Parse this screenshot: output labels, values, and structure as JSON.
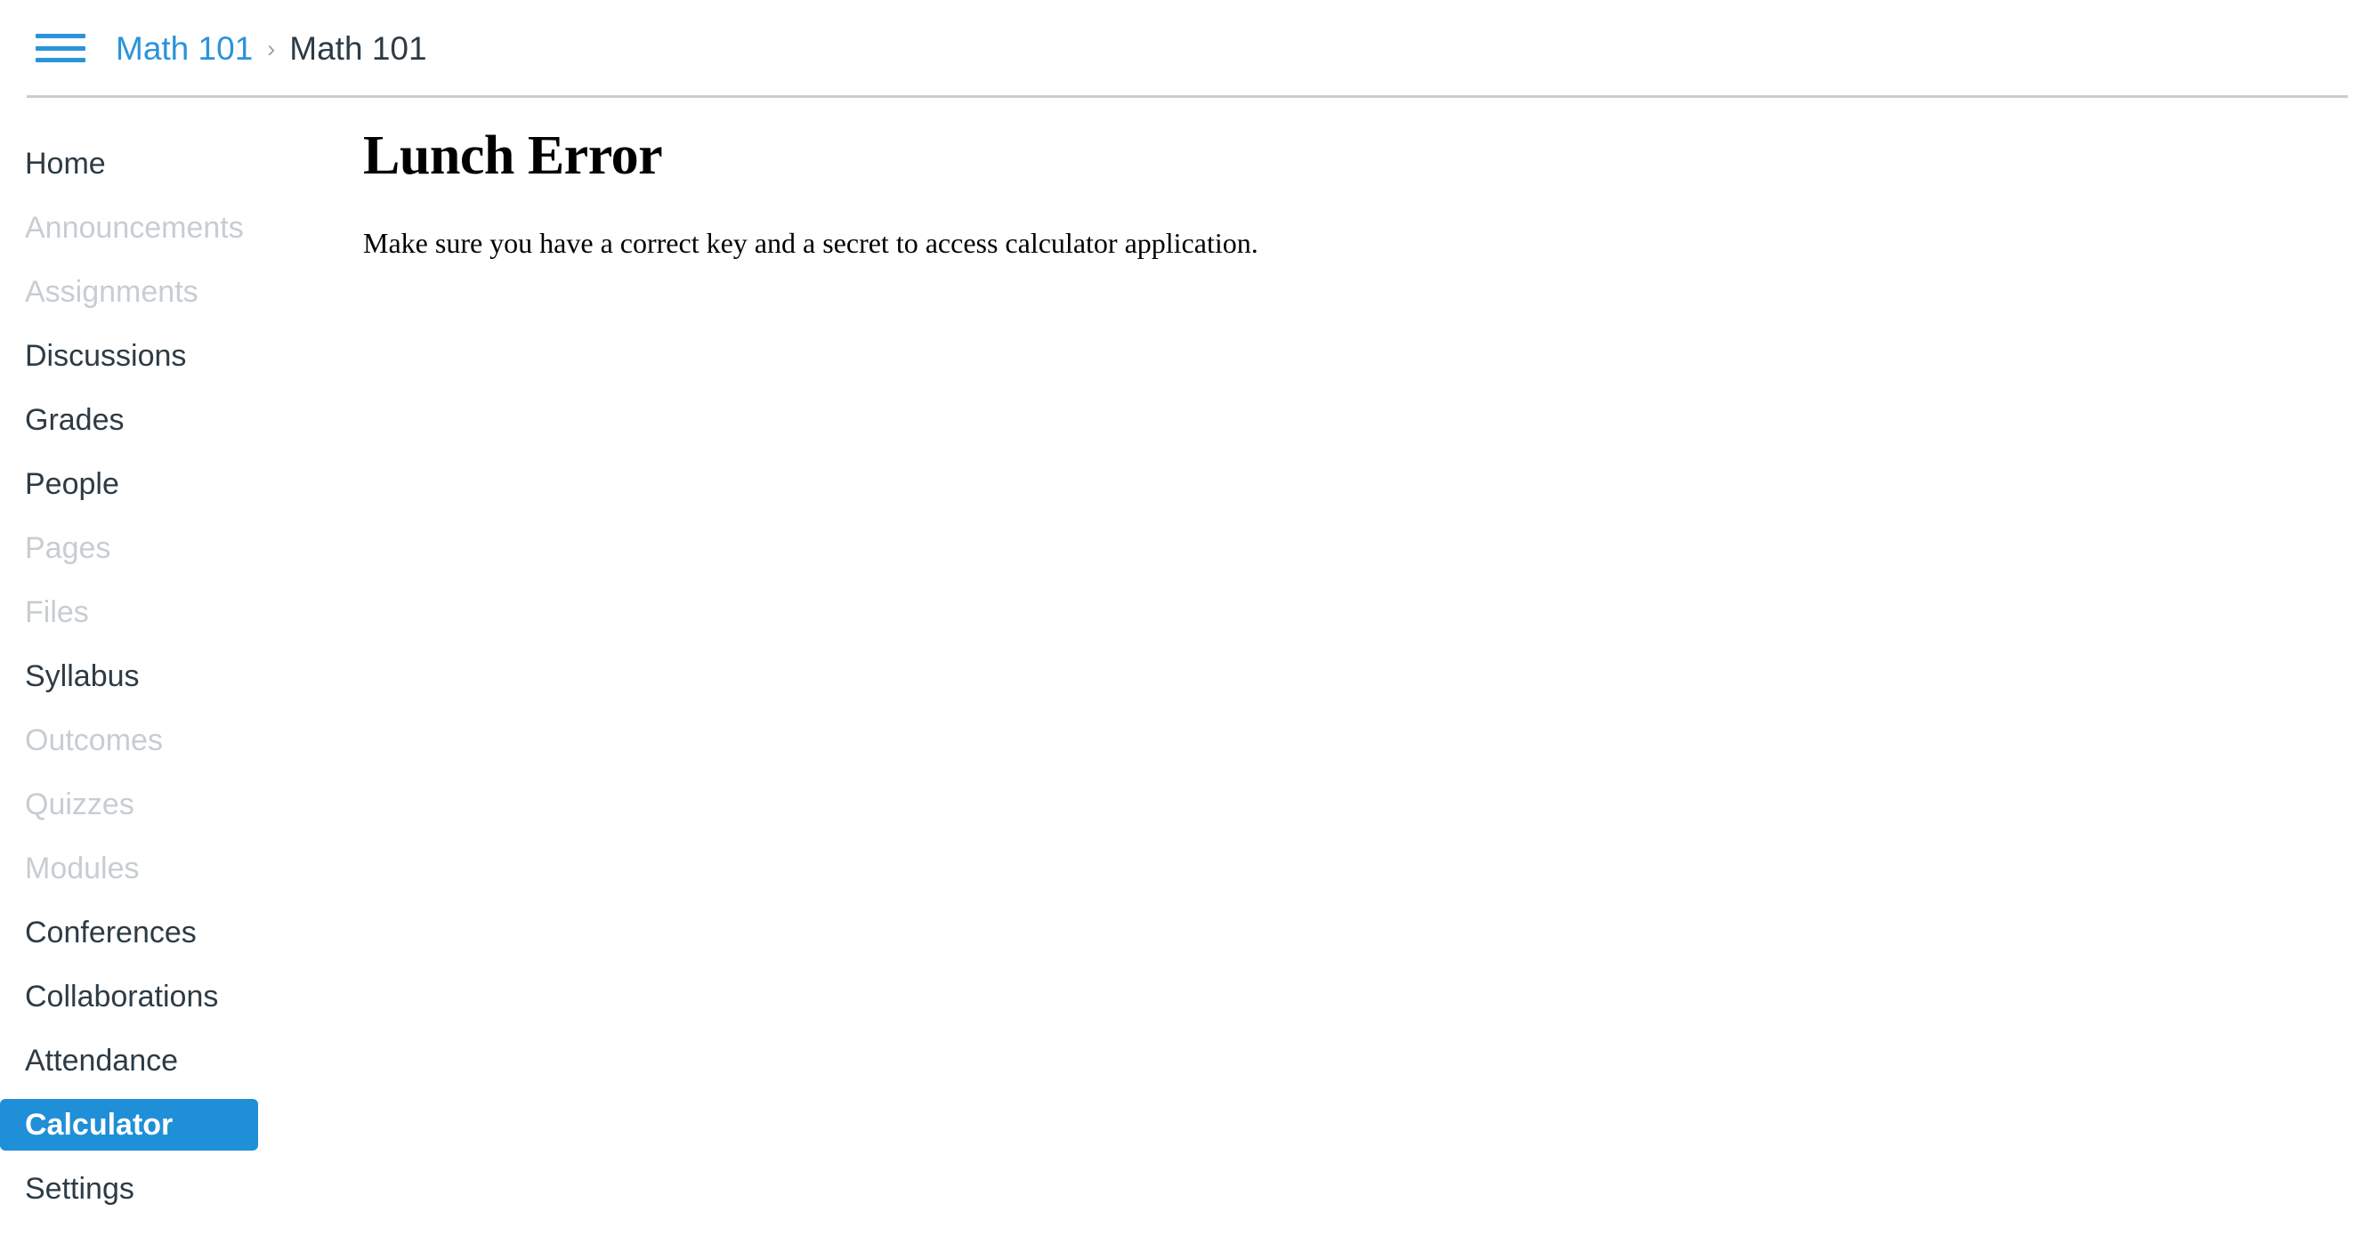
{
  "header": {
    "menu_icon": "hamburger-icon",
    "breadcrumb": {
      "parent": "Math 101",
      "separator": "›",
      "current": "Math 101"
    }
  },
  "sidebar": {
    "items": [
      {
        "label": "Home",
        "state": "enabled"
      },
      {
        "label": "Announcements",
        "state": "disabled"
      },
      {
        "label": "Assignments",
        "state": "disabled"
      },
      {
        "label": "Discussions",
        "state": "enabled"
      },
      {
        "label": "Grades",
        "state": "enabled"
      },
      {
        "label": "People",
        "state": "enabled"
      },
      {
        "label": "Pages",
        "state": "disabled"
      },
      {
        "label": "Files",
        "state": "disabled"
      },
      {
        "label": "Syllabus",
        "state": "enabled"
      },
      {
        "label": "Outcomes",
        "state": "disabled"
      },
      {
        "label": "Quizzes",
        "state": "disabled"
      },
      {
        "label": "Modules",
        "state": "disabled"
      },
      {
        "label": "Conferences",
        "state": "enabled"
      },
      {
        "label": "Collaborations",
        "state": "enabled"
      },
      {
        "label": "Attendance",
        "state": "enabled"
      },
      {
        "label": "Calculator",
        "state": "active"
      },
      {
        "label": "Settings",
        "state": "enabled"
      }
    ]
  },
  "main": {
    "title": "Lunch Error",
    "body": "Make sure you have a correct key and a secret to access calculator application."
  },
  "colors": {
    "link_blue": "#2B93DB",
    "active_blue": "#1F8FD8",
    "text_dark": "#2D3B45",
    "text_disabled": "#C7CDD1",
    "divider": "#C7CDD1"
  }
}
